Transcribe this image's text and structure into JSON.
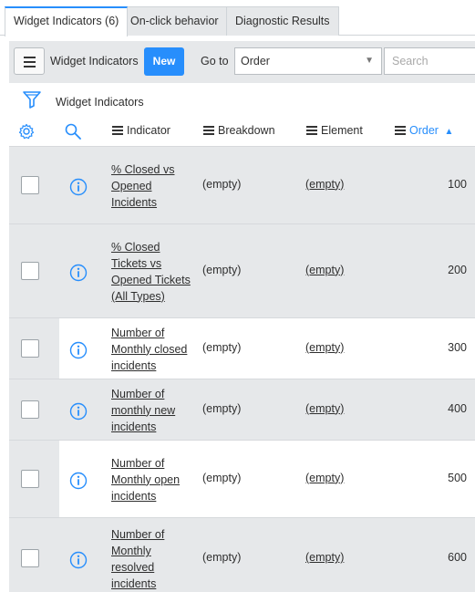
{
  "tabs": [
    {
      "label": "Widget Indicators (6)"
    },
    {
      "label": "On-click behavior"
    },
    {
      "label": "Diagnostic Results"
    }
  ],
  "header": {
    "title": "Widget Indicators",
    "new_label": "New",
    "goto_label": "Go to",
    "goto_value": "Order",
    "search_placeholder": "Search"
  },
  "breadcrumb": "Widget Indicators",
  "columns": {
    "indicator": "Indicator",
    "breakdown": "Breakdown",
    "element": "Element",
    "order": "Order",
    "sort_direction": "ascending"
  },
  "rows": [
    {
      "indicator": [
        "% Closed vs",
        "Opened",
        "Incidents"
      ],
      "breakdown": "(empty)",
      "element": "(empty)",
      "order": "100"
    },
    {
      "indicator": [
        "% Closed",
        "Tickets vs",
        "Opened Tickets",
        "(All Types)"
      ],
      "breakdown": "(empty)",
      "element": "(empty)",
      "order": "200"
    },
    {
      "indicator": [
        "Number of",
        "Monthly closed",
        "incidents"
      ],
      "breakdown": "(empty)",
      "element": "(empty)",
      "order": "300"
    },
    {
      "indicator": [
        "Number of",
        "monthly new",
        "incidents"
      ],
      "breakdown": "(empty)",
      "element": "(empty)",
      "order": "400"
    },
    {
      "indicator": [
        "Number of",
        "Monthly open",
        "incidents"
      ],
      "breakdown": "(empty)",
      "element": "(empty)",
      "order": "500"
    },
    {
      "indicator": [
        "Number of",
        "Monthly",
        "resolved",
        "incidents"
      ],
      "breakdown": "(empty)",
      "element": "(empty)",
      "order": "600"
    }
  ],
  "colors": {
    "accent": "#278efc",
    "header_bg": "#e6e8ea",
    "icon_blue": "#278efc"
  }
}
